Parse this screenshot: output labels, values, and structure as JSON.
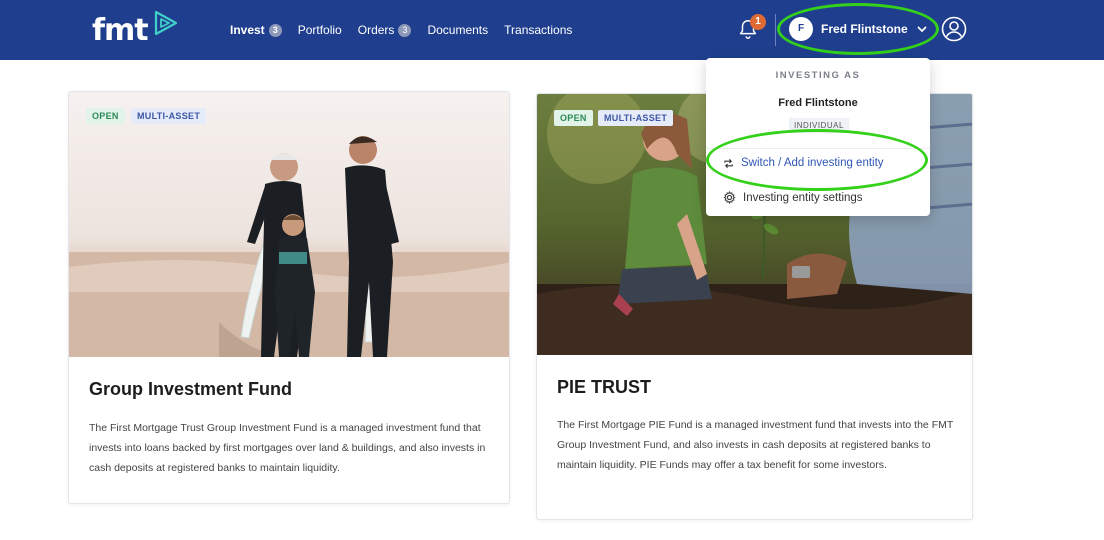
{
  "brand": {
    "logo_text": "fmt",
    "accent": "#1f3f8e",
    "highlight": "#34d11a"
  },
  "nav": {
    "items": [
      {
        "label": "Invest",
        "badge": "3"
      },
      {
        "label": "Portfolio",
        "badge": ""
      },
      {
        "label": "Orders",
        "badge": "3"
      },
      {
        "label": "Documents",
        "badge": ""
      },
      {
        "label": "Transactions",
        "badge": ""
      }
    ]
  },
  "header": {
    "notifications_count": "1",
    "user_initial": "F",
    "user_name": "Fred Flintstone"
  },
  "dropdown": {
    "label": "INVESTING AS",
    "name": "Fred Flintstone",
    "entity_type": "INDIVIDUAL",
    "switch_label": "Switch / Add investing entity",
    "settings_label": "Investing entity settings"
  },
  "cards": [
    {
      "tags": [
        "OPEN",
        "MULTI-ASSET"
      ],
      "title": "Group Investment Fund",
      "description": "The First Mortgage Trust Group Investment Fund is a managed investment fund that invests into loans backed by first mortgages over land & buildings, and also invests in cash deposits at registered banks to maintain liquidity."
    },
    {
      "tags": [
        "OPEN",
        "MULTI-ASSET"
      ],
      "title": "PIE TRUST",
      "description": "The First Mortgage PIE Fund is a managed investment fund that invests into the FMT Group Investment Fund, and also invests in cash deposits at registered banks to maintain liquidity. PIE Funds may offer a tax benefit for some investors."
    }
  ]
}
